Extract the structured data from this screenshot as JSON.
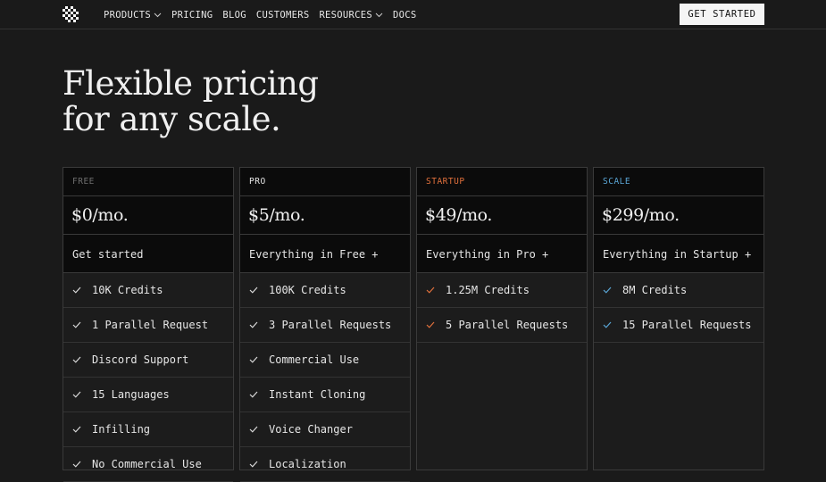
{
  "nav": {
    "links": [
      "PRODUCTS",
      "PRICING",
      "BLOG",
      "CUSTOMERS",
      "RESOURCES",
      "DOCS"
    ],
    "cta": "GET STARTED"
  },
  "hero": {
    "line1": "Flexible pricing",
    "line2": "for any scale."
  },
  "plans": [
    {
      "tier": "FREE",
      "tier_color": "#6e6e6e",
      "check_color": "#d8d8d8",
      "price": "$0/mo.",
      "description": "Get started",
      "features": [
        "10K Credits",
        "1 Parallel Request",
        "Discord Support",
        "15 Languages",
        "Infilling",
        "No Commercial Use"
      ]
    },
    {
      "tier": "PRO",
      "tier_color": "#e6e6e6",
      "check_color": "#d8d8d8",
      "price": "$5/mo.",
      "description": "Everything in Free +",
      "features": [
        "100K Credits",
        "3 Parallel Requests",
        "Commercial Use",
        "Instant Cloning",
        "Voice Changer",
        "Localization"
      ]
    },
    {
      "tier": "STARTUP",
      "tier_color": "#e0703c",
      "check_color": "#e0703c",
      "price": "$49/mo.",
      "description": "Everything in Pro +",
      "features": [
        "1.25M Credits",
        "5 Parallel Requests"
      ]
    },
    {
      "tier": "SCALE",
      "tier_color": "#5aa6d6",
      "check_color": "#5aa6d6",
      "price": "$299/mo.",
      "description": "Everything in Startup +",
      "features": [
        "8M Credits",
        "15 Parallel Requests"
      ]
    }
  ]
}
